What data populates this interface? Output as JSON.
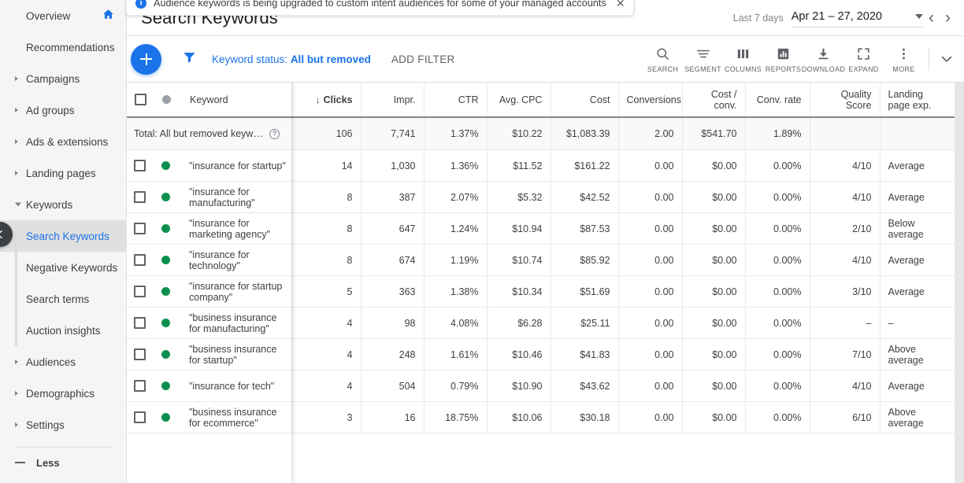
{
  "banner": {
    "icon": "info-icon",
    "text": "Audience keywords is being upgraded to custom intent audiences for some of your managed accounts",
    "close_label": "✕"
  },
  "sidebar": {
    "items": [
      {
        "label": "Overview",
        "type": "item",
        "icon": "home-icon",
        "expandable": false,
        "selected": false
      },
      {
        "label": "Recommendations",
        "type": "item",
        "expandable": false,
        "selected": false
      },
      {
        "label": "Campaigns",
        "type": "item",
        "expandable": true,
        "selected": false
      },
      {
        "label": "Ad groups",
        "type": "item",
        "expandable": true,
        "selected": false
      },
      {
        "label": "Ads & extensions",
        "type": "item",
        "expandable": true,
        "selected": false
      },
      {
        "label": "Landing pages",
        "type": "item",
        "expandable": true,
        "selected": false
      },
      {
        "label": "Keywords",
        "type": "item",
        "expandable": true,
        "expanded": true,
        "selected": false
      },
      {
        "label": "Search Keywords",
        "type": "sub",
        "selected": true
      },
      {
        "label": "Negative Keywords",
        "type": "sub",
        "selected": false
      },
      {
        "label": "Search terms",
        "type": "sub",
        "selected": false
      },
      {
        "label": "Auction insights",
        "type": "sub",
        "selected": false
      },
      {
        "label": "Audiences",
        "type": "item",
        "expandable": true,
        "selected": false
      },
      {
        "label": "Demographics",
        "type": "item",
        "expandable": true,
        "selected": false
      },
      {
        "label": "Settings",
        "type": "item",
        "expandable": true,
        "selected": false
      }
    ],
    "less_label": "Less",
    "collapse_icon": "chevron-left-icon"
  },
  "header": {
    "title": "Search Keywords",
    "date_preset": "Last 7 days",
    "date_range": "Apr 21 – 27, 2020",
    "prev_icon": "chevron-left-icon",
    "next_icon": "chevron-right-icon",
    "dropdown_icon": "chevron-down-icon"
  },
  "toolbar": {
    "add_icon": "plus-icon",
    "filter_icon": "filter-icon",
    "keyword_status_prefix": "Keyword status:",
    "keyword_status_value": "All but removed",
    "add_filter_label": "ADD FILTER",
    "tools": [
      {
        "label": "SEARCH",
        "icon": "search-icon"
      },
      {
        "label": "SEGMENT",
        "icon": "segment-icon"
      },
      {
        "label": "COLUMNS",
        "icon": "columns-icon"
      },
      {
        "label": "REPORTS",
        "icon": "reports-icon"
      },
      {
        "label": "DOWNLOAD",
        "icon": "download-icon"
      },
      {
        "label": "EXPAND",
        "icon": "expand-icon"
      },
      {
        "label": "MORE",
        "icon": "more-vert-icon"
      }
    ],
    "collapse_icon": "chevron-down-icon"
  },
  "table": {
    "columns": [
      {
        "key": "keyword",
        "label": "Keyword",
        "align": "left",
        "sorted": false
      },
      {
        "key": "clicks",
        "label": "Clicks",
        "align": "right",
        "sorted": true,
        "sort_dir": "↓"
      },
      {
        "key": "impr",
        "label": "Impr.",
        "align": "right",
        "sorted": false
      },
      {
        "key": "ctr",
        "label": "CTR",
        "align": "right",
        "sorted": false
      },
      {
        "key": "avg_cpc",
        "label": "Avg. CPC",
        "align": "right",
        "sorted": false
      },
      {
        "key": "cost",
        "label": "Cost",
        "align": "right",
        "sorted": false
      },
      {
        "key": "conversions",
        "label": "Conversions",
        "align": "right",
        "sorted": false
      },
      {
        "key": "cost_conv",
        "label": "Cost / conv.",
        "align": "right",
        "sorted": false
      },
      {
        "key": "conv_rate",
        "label": "Conv. rate",
        "align": "right",
        "sorted": false
      },
      {
        "key": "quality_score",
        "label": "Quality Score",
        "align": "right",
        "sorted": false
      },
      {
        "key": "landing_page_exp",
        "label": "Landing page exp.",
        "align": "left",
        "sorted": false
      }
    ],
    "select_all_icon": "checkbox-unchecked-icon",
    "status_header_icon": "status-dot-icon",
    "total_row": {
      "label": "Total: All but removed keyw…",
      "help_icon": "help-icon",
      "clicks": "106",
      "impr": "7,741",
      "ctr": "1.37%",
      "avg_cpc": "$10.22",
      "cost": "$1,083.39",
      "conversions": "2.00",
      "cost_conv": "$541.70",
      "conv_rate": "1.89%",
      "quality_score": "",
      "landing_page_exp": ""
    },
    "rows": [
      {
        "status": "enabled",
        "keyword": "\"insurance for startup\"",
        "clicks": "14",
        "impr": "1,030",
        "ctr": "1.36%",
        "avg_cpc": "$11.52",
        "cost": "$161.22",
        "conversions": "0.00",
        "cost_conv": "$0.00",
        "conv_rate": "0.00%",
        "quality_score": "4/10",
        "landing_page_exp": "Average"
      },
      {
        "status": "enabled",
        "keyword": "\"insurance for manufacturing\"",
        "clicks": "8",
        "impr": "387",
        "ctr": "2.07%",
        "avg_cpc": "$5.32",
        "cost": "$42.52",
        "conversions": "0.00",
        "cost_conv": "$0.00",
        "conv_rate": "0.00%",
        "quality_score": "4/10",
        "landing_page_exp": "Average"
      },
      {
        "status": "enabled",
        "keyword": "\"insurance for marketing agency\"",
        "clicks": "8",
        "impr": "647",
        "ctr": "1.24%",
        "avg_cpc": "$10.94",
        "cost": "$87.53",
        "conversions": "0.00",
        "cost_conv": "$0.00",
        "conv_rate": "0.00%",
        "quality_score": "2/10",
        "landing_page_exp": "Below average"
      },
      {
        "status": "enabled",
        "keyword": "\"insurance for technology\"",
        "clicks": "8",
        "impr": "674",
        "ctr": "1.19%",
        "avg_cpc": "$10.74",
        "cost": "$85.92",
        "conversions": "0.00",
        "cost_conv": "$0.00",
        "conv_rate": "0.00%",
        "quality_score": "4/10",
        "landing_page_exp": "Average"
      },
      {
        "status": "enabled",
        "keyword": "\"insurance for startup company\"",
        "clicks": "5",
        "impr": "363",
        "ctr": "1.38%",
        "avg_cpc": "$10.34",
        "cost": "$51.69",
        "conversions": "0.00",
        "cost_conv": "$0.00",
        "conv_rate": "0.00%",
        "quality_score": "3/10",
        "landing_page_exp": "Average"
      },
      {
        "status": "enabled",
        "keyword": "\"business insurance for manufacturing\"",
        "clicks": "4",
        "impr": "98",
        "ctr": "4.08%",
        "avg_cpc": "$6.28",
        "cost": "$25.11",
        "conversions": "0.00",
        "cost_conv": "$0.00",
        "conv_rate": "0.00%",
        "quality_score": "–",
        "landing_page_exp": "–"
      },
      {
        "status": "enabled",
        "keyword": "\"business insurance for startup\"",
        "clicks": "4",
        "impr": "248",
        "ctr": "1.61%",
        "avg_cpc": "$10.46",
        "cost": "$41.83",
        "conversions": "0.00",
        "cost_conv": "$0.00",
        "conv_rate": "0.00%",
        "quality_score": "7/10",
        "landing_page_exp": "Above average"
      },
      {
        "status": "enabled",
        "keyword": "\"insurance for tech\"",
        "clicks": "4",
        "impr": "504",
        "ctr": "0.79%",
        "avg_cpc": "$10.90",
        "cost": "$43.62",
        "conversions": "0.00",
        "cost_conv": "$0.00",
        "conv_rate": "0.00%",
        "quality_score": "4/10",
        "landing_page_exp": "Average"
      },
      {
        "status": "enabled",
        "keyword": "\"business insurance for ecommerce\"",
        "clicks": "3",
        "impr": "16",
        "ctr": "18.75%",
        "avg_cpc": "$10.06",
        "cost": "$30.18",
        "conversions": "0.00",
        "cost_conv": "$0.00",
        "conv_rate": "0.00%",
        "quality_score": "6/10",
        "landing_page_exp": "Above average"
      }
    ]
  },
  "colors": {
    "accent_blue": "#1a73e8",
    "status_green": "#0d904f",
    "text_primary": "#3c4043",
    "text_muted": "#80868b",
    "sidebar_bg": "#f5f5f5",
    "total_row_bg": "#f8f9fa"
  }
}
